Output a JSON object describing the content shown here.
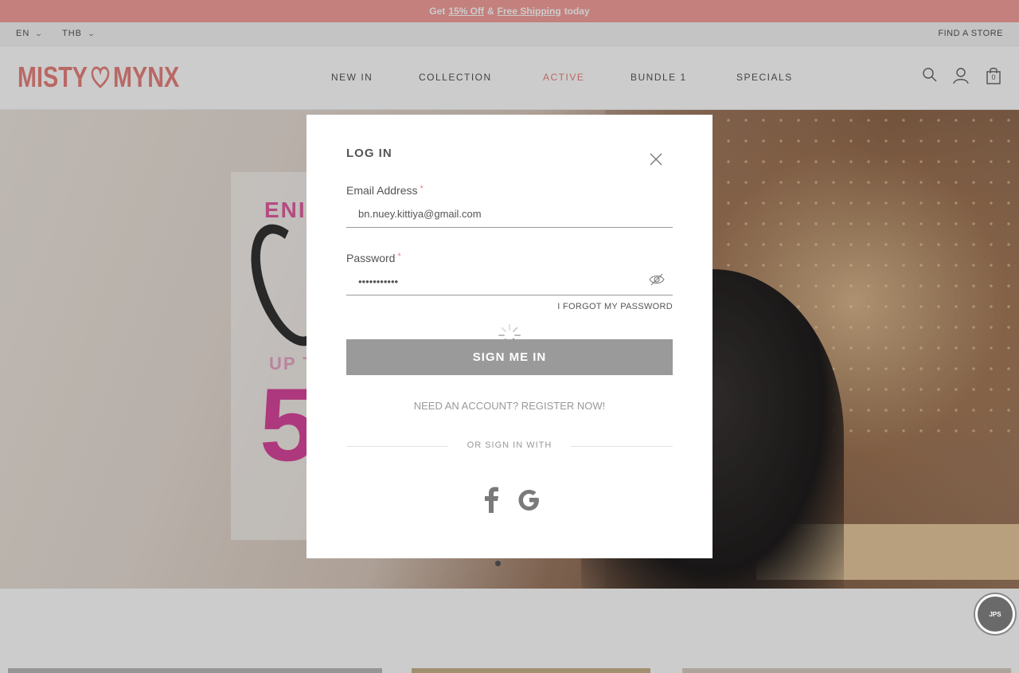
{
  "promo": {
    "prefix": "Get",
    "discount": "15% Off",
    "amp": "&",
    "shipping": "Free Shipping",
    "suffix": "today"
  },
  "utility": {
    "language": "EN",
    "currency": "THB",
    "find_store": "FIND A STORE"
  },
  "header": {
    "logo_left": "MISTY",
    "logo_right": "MYNX",
    "nav": [
      {
        "label": "NEW IN",
        "active": false
      },
      {
        "label": "COLLECTION",
        "active": false
      },
      {
        "label": "ACTIVE",
        "active": true
      },
      {
        "label": "BUNDLE 1",
        "active": false
      },
      {
        "label": "SPECIALS",
        "active": false
      }
    ],
    "cart_count": "0",
    "icons": [
      "search-icon",
      "account-icon",
      "cart-icon"
    ]
  },
  "hero": {
    "line_1": "ENI",
    "line_2": "UP T",
    "big_number": "5"
  },
  "chat": {
    "label": "JPS"
  },
  "modal": {
    "title": "LOG IN",
    "email_label": "Email Address",
    "email_value": "bn.nuey.kittiya@gmail.com",
    "password_label": "Password",
    "password_value": "•••••••••••",
    "required_mark": "*",
    "forgot": "I FORGOT MY PASSWORD",
    "submit": "SIGN ME IN",
    "register": "NEED AN ACCOUNT? REGISTER NOW!",
    "or_sign_in": "OR SIGN IN WITH",
    "social": [
      "facebook-icon",
      "google-icon"
    ]
  },
  "colors": {
    "brand": "#e8837f",
    "promo_bg": "#f4a19d",
    "button": "#9a9a9a",
    "hero_pink": "#d9479d"
  }
}
